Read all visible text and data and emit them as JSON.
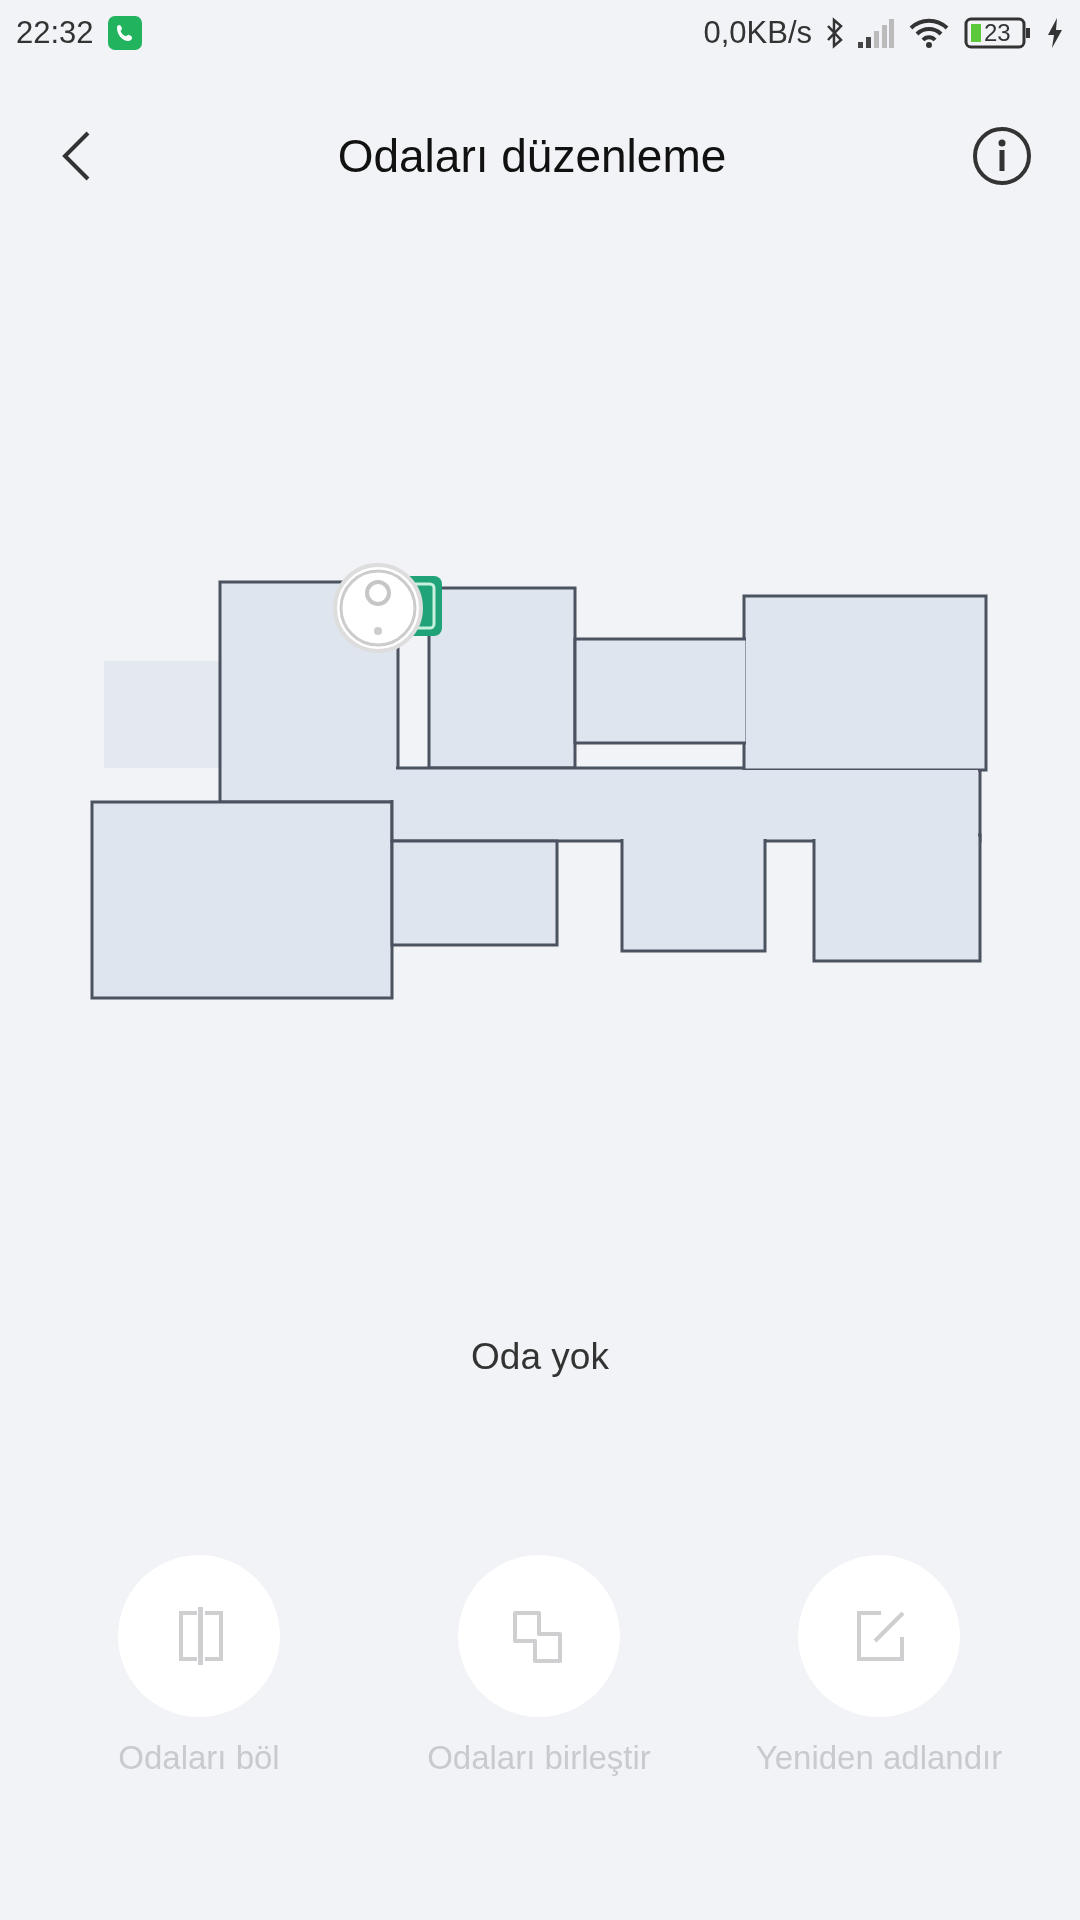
{
  "status_bar": {
    "time": "22:32",
    "net_speed": "0,0KB/s",
    "battery": "23"
  },
  "header": {
    "title": "Odaları düzenleme"
  },
  "message": "Oda yok",
  "actions": [
    {
      "label": "Odaları böl",
      "kind": "split",
      "disabled": true
    },
    {
      "label": "Odaları birleştir",
      "kind": "merge",
      "disabled": true
    },
    {
      "label": "Yeniden adlandır",
      "kind": "rename",
      "disabled": true
    }
  ]
}
